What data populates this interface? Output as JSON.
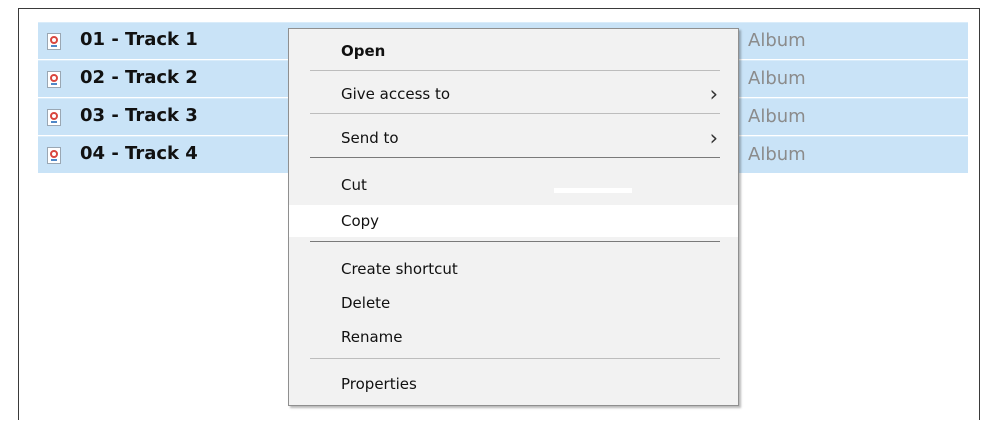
{
  "file_list": {
    "rows": [
      {
        "name": "01 - Track 1",
        "album": "Album",
        "icon": "audio-file-icon"
      },
      {
        "name": "02 - Track 2",
        "album": "Album",
        "icon": "audio-file-icon"
      },
      {
        "name": "03 - Track 3",
        "album": "Album",
        "icon": "audio-file-icon"
      },
      {
        "name": "04 - Track 4",
        "album": "Album",
        "icon": "audio-file-icon"
      }
    ]
  },
  "context_menu": {
    "items": [
      {
        "label": "Open",
        "bold": true
      },
      {
        "label": "Give access to",
        "submenu": true
      },
      {
        "label": "Send to",
        "submenu": true
      },
      {
        "label": "Cut"
      },
      {
        "label": "Copy",
        "highlighted": true
      },
      {
        "label": "Create shortcut"
      },
      {
        "label": "Delete"
      },
      {
        "label": "Rename"
      },
      {
        "label": "Properties"
      }
    ],
    "submenu_arrow": "›"
  },
  "colors": {
    "selection": "#c9e3f7",
    "menu_background": "#f2f2f2",
    "highlight": "#ffffff",
    "album_text": "#8b8b8b"
  }
}
